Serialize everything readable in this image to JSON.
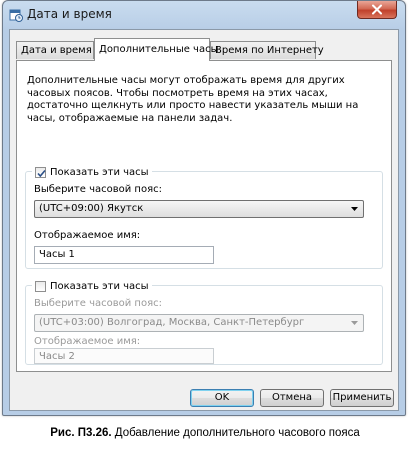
{
  "window": {
    "title": "Дата и время",
    "icon": "clock-calendar-icon",
    "close_icon": "close-icon"
  },
  "tabs": [
    {
      "label": "Дата и время",
      "active": false
    },
    {
      "label": "Дополнительные часы",
      "active": true
    },
    {
      "label": "Время по Интернету",
      "active": false
    }
  ],
  "panel": {
    "description": "Дополнительные часы могут отображать время для других часовых поясов. Чтобы посмотреть время на этих часах, достаточно щелкнуть или просто навести указатель мыши на часы, отображаемые на панели задач.",
    "clock1": {
      "show_label": "Показать эти часы",
      "show_checked": true,
      "timezone_label": "Выберите часовой пояс:",
      "timezone_value": "(UTC+09:00) Якутск",
      "name_label": "Отображаемое имя:",
      "name_value": "Часы 1"
    },
    "clock2": {
      "show_label": "Показать эти часы",
      "show_checked": false,
      "timezone_label": "Выберите часовой пояс:",
      "timezone_value": "(UTC+03:00) Волгоград, Москва, Санкт-Петербург",
      "name_label": "Отображаемое имя:",
      "name_value": "Часы 2"
    }
  },
  "buttons": {
    "ok": "OK",
    "cancel": "Отмена",
    "apply": "Применить"
  },
  "caption": {
    "number": "Рис. П3.26.",
    "text": " Добавление дополнительного часового пояса"
  }
}
